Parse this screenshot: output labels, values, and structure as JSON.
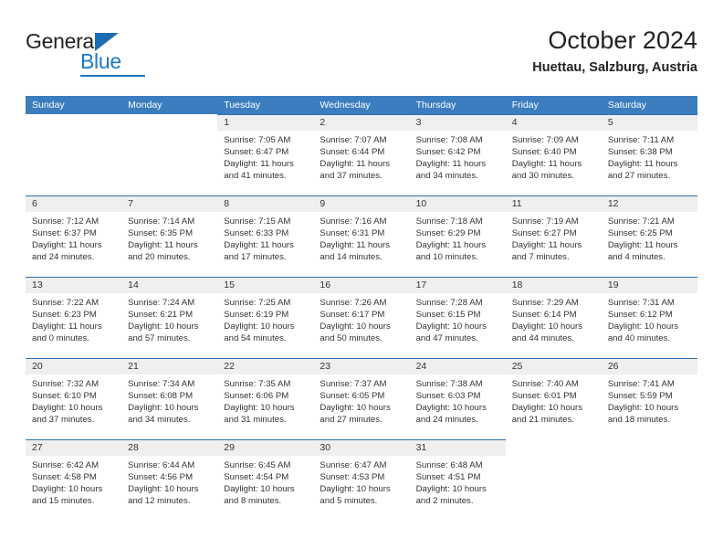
{
  "brand": {
    "name_part1": "General",
    "name_part2": "Blue",
    "accent_color": "#1b7ac4",
    "triangle_color": "#1b6cb0"
  },
  "header": {
    "title": "October 2024",
    "subtitle": "Huettau, Salzburg, Austria"
  },
  "calendar": {
    "header_bg": "#3b7dbf",
    "cell_header_bg": "#efefef",
    "divider_color": "#2f6fab",
    "weekdays": [
      "Sunday",
      "Monday",
      "Tuesday",
      "Wednesday",
      "Thursday",
      "Friday",
      "Saturday"
    ],
    "weeks": [
      [
        {
          "day": "",
          "sunrise": "",
          "sunset": "",
          "daylight": ""
        },
        {
          "day": "",
          "sunrise": "",
          "sunset": "",
          "daylight": ""
        },
        {
          "day": "1",
          "sunrise": "Sunrise: 7:05 AM",
          "sunset": "Sunset: 6:47 PM",
          "daylight": "Daylight: 11 hours and 41 minutes."
        },
        {
          "day": "2",
          "sunrise": "Sunrise: 7:07 AM",
          "sunset": "Sunset: 6:44 PM",
          "daylight": "Daylight: 11 hours and 37 minutes."
        },
        {
          "day": "3",
          "sunrise": "Sunrise: 7:08 AM",
          "sunset": "Sunset: 6:42 PM",
          "daylight": "Daylight: 11 hours and 34 minutes."
        },
        {
          "day": "4",
          "sunrise": "Sunrise: 7:09 AM",
          "sunset": "Sunset: 6:40 PM",
          "daylight": "Daylight: 11 hours and 30 minutes."
        },
        {
          "day": "5",
          "sunrise": "Sunrise: 7:11 AM",
          "sunset": "Sunset: 6:38 PM",
          "daylight": "Daylight: 11 hours and 27 minutes."
        }
      ],
      [
        {
          "day": "6",
          "sunrise": "Sunrise: 7:12 AM",
          "sunset": "Sunset: 6:37 PM",
          "daylight": "Daylight: 11 hours and 24 minutes."
        },
        {
          "day": "7",
          "sunrise": "Sunrise: 7:14 AM",
          "sunset": "Sunset: 6:35 PM",
          "daylight": "Daylight: 11 hours and 20 minutes."
        },
        {
          "day": "8",
          "sunrise": "Sunrise: 7:15 AM",
          "sunset": "Sunset: 6:33 PM",
          "daylight": "Daylight: 11 hours and 17 minutes."
        },
        {
          "day": "9",
          "sunrise": "Sunrise: 7:16 AM",
          "sunset": "Sunset: 6:31 PM",
          "daylight": "Daylight: 11 hours and 14 minutes."
        },
        {
          "day": "10",
          "sunrise": "Sunrise: 7:18 AM",
          "sunset": "Sunset: 6:29 PM",
          "daylight": "Daylight: 11 hours and 10 minutes."
        },
        {
          "day": "11",
          "sunrise": "Sunrise: 7:19 AM",
          "sunset": "Sunset: 6:27 PM",
          "daylight": "Daylight: 11 hours and 7 minutes."
        },
        {
          "day": "12",
          "sunrise": "Sunrise: 7:21 AM",
          "sunset": "Sunset: 6:25 PM",
          "daylight": "Daylight: 11 hours and 4 minutes."
        }
      ],
      [
        {
          "day": "13",
          "sunrise": "Sunrise: 7:22 AM",
          "sunset": "Sunset: 6:23 PM",
          "daylight": "Daylight: 11 hours and 0 minutes."
        },
        {
          "day": "14",
          "sunrise": "Sunrise: 7:24 AM",
          "sunset": "Sunset: 6:21 PM",
          "daylight": "Daylight: 10 hours and 57 minutes."
        },
        {
          "day": "15",
          "sunrise": "Sunrise: 7:25 AM",
          "sunset": "Sunset: 6:19 PM",
          "daylight": "Daylight: 10 hours and 54 minutes."
        },
        {
          "day": "16",
          "sunrise": "Sunrise: 7:26 AM",
          "sunset": "Sunset: 6:17 PM",
          "daylight": "Daylight: 10 hours and 50 minutes."
        },
        {
          "day": "17",
          "sunrise": "Sunrise: 7:28 AM",
          "sunset": "Sunset: 6:15 PM",
          "daylight": "Daylight: 10 hours and 47 minutes."
        },
        {
          "day": "18",
          "sunrise": "Sunrise: 7:29 AM",
          "sunset": "Sunset: 6:14 PM",
          "daylight": "Daylight: 10 hours and 44 minutes."
        },
        {
          "day": "19",
          "sunrise": "Sunrise: 7:31 AM",
          "sunset": "Sunset: 6:12 PM",
          "daylight": "Daylight: 10 hours and 40 minutes."
        }
      ],
      [
        {
          "day": "20",
          "sunrise": "Sunrise: 7:32 AM",
          "sunset": "Sunset: 6:10 PM",
          "daylight": "Daylight: 10 hours and 37 minutes."
        },
        {
          "day": "21",
          "sunrise": "Sunrise: 7:34 AM",
          "sunset": "Sunset: 6:08 PM",
          "daylight": "Daylight: 10 hours and 34 minutes."
        },
        {
          "day": "22",
          "sunrise": "Sunrise: 7:35 AM",
          "sunset": "Sunset: 6:06 PM",
          "daylight": "Daylight: 10 hours and 31 minutes."
        },
        {
          "day": "23",
          "sunrise": "Sunrise: 7:37 AM",
          "sunset": "Sunset: 6:05 PM",
          "daylight": "Daylight: 10 hours and 27 minutes."
        },
        {
          "day": "24",
          "sunrise": "Sunrise: 7:38 AM",
          "sunset": "Sunset: 6:03 PM",
          "daylight": "Daylight: 10 hours and 24 minutes."
        },
        {
          "day": "25",
          "sunrise": "Sunrise: 7:40 AM",
          "sunset": "Sunset: 6:01 PM",
          "daylight": "Daylight: 10 hours and 21 minutes."
        },
        {
          "day": "26",
          "sunrise": "Sunrise: 7:41 AM",
          "sunset": "Sunset: 5:59 PM",
          "daylight": "Daylight: 10 hours and 18 minutes."
        }
      ],
      [
        {
          "day": "27",
          "sunrise": "Sunrise: 6:42 AM",
          "sunset": "Sunset: 4:58 PM",
          "daylight": "Daylight: 10 hours and 15 minutes."
        },
        {
          "day": "28",
          "sunrise": "Sunrise: 6:44 AM",
          "sunset": "Sunset: 4:56 PM",
          "daylight": "Daylight: 10 hours and 12 minutes."
        },
        {
          "day": "29",
          "sunrise": "Sunrise: 6:45 AM",
          "sunset": "Sunset: 4:54 PM",
          "daylight": "Daylight: 10 hours and 8 minutes."
        },
        {
          "day": "30",
          "sunrise": "Sunrise: 6:47 AM",
          "sunset": "Sunset: 4:53 PM",
          "daylight": "Daylight: 10 hours and 5 minutes."
        },
        {
          "day": "31",
          "sunrise": "Sunrise: 6:48 AM",
          "sunset": "Sunset: 4:51 PM",
          "daylight": "Daylight: 10 hours and 2 minutes."
        },
        {
          "day": "",
          "sunrise": "",
          "sunset": "",
          "daylight": ""
        },
        {
          "day": "",
          "sunrise": "",
          "sunset": "",
          "daylight": ""
        }
      ]
    ]
  }
}
